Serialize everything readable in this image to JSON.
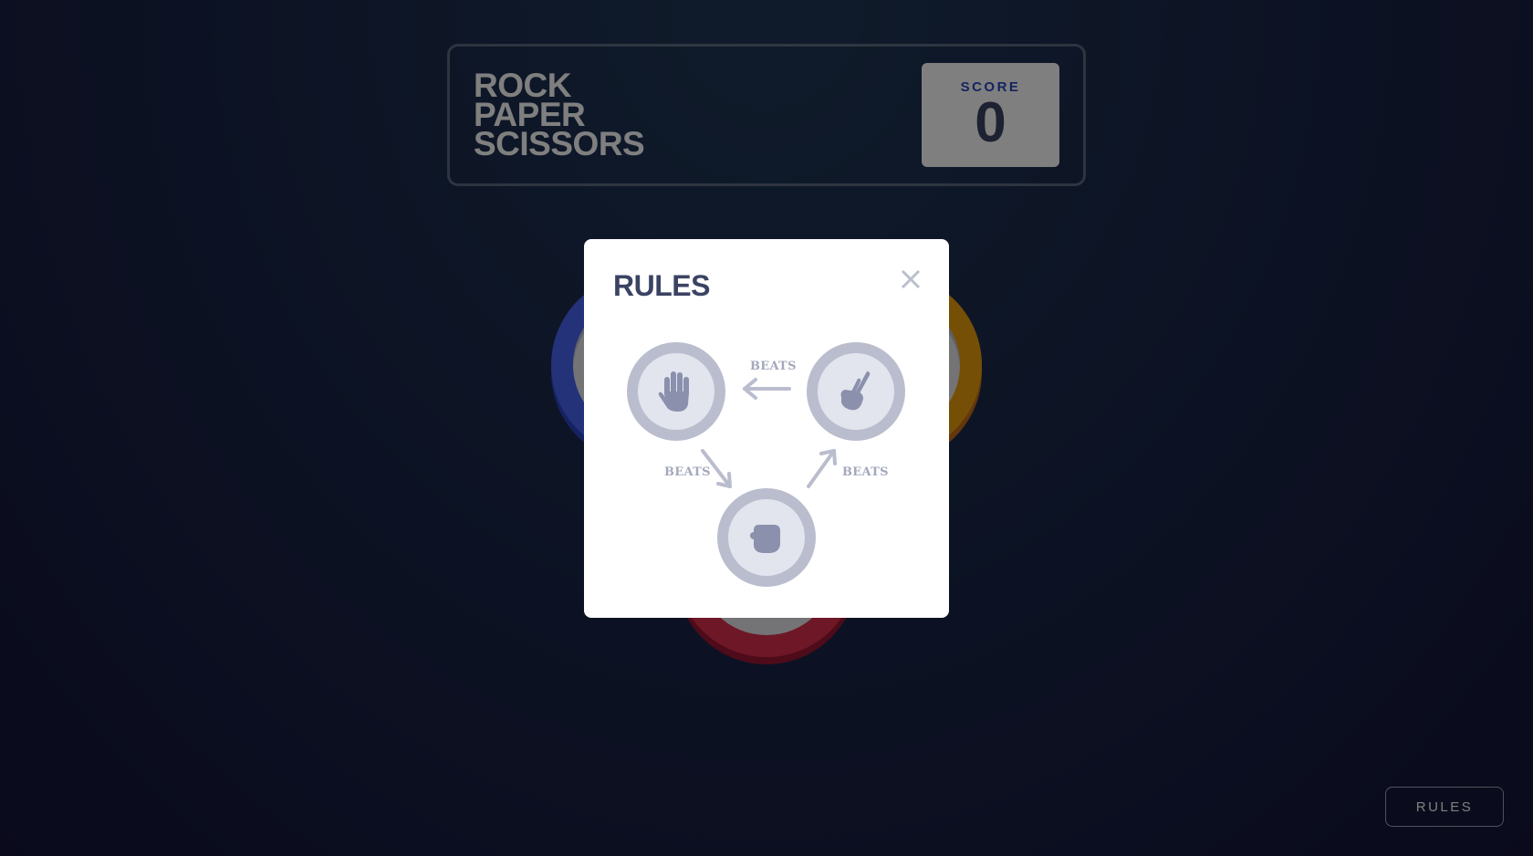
{
  "header": {
    "logo_lines": [
      "ROCK",
      "PAPER",
      "SCISSORS"
    ],
    "score_label": "SCORE",
    "score_value": "0"
  },
  "choices": [
    {
      "name": "paper",
      "icon": "paper-hand-icon",
      "color": "#4865f4"
    },
    {
      "name": "scissors",
      "icon": "scissors-hand-icon",
      "color": "#ec9e0e"
    },
    {
      "name": "rock",
      "icon": "rock-fist-icon",
      "color": "#dc2e4e"
    }
  ],
  "rules_button_label": "RULES",
  "modal": {
    "title": "RULES",
    "close_icon": "close-icon",
    "beats_label": "BEATS",
    "relations": [
      {
        "winner": "scissors",
        "loser": "paper"
      },
      {
        "winner": "paper",
        "loser": "rock"
      },
      {
        "winner": "rock",
        "loser": "scissors"
      }
    ]
  }
}
